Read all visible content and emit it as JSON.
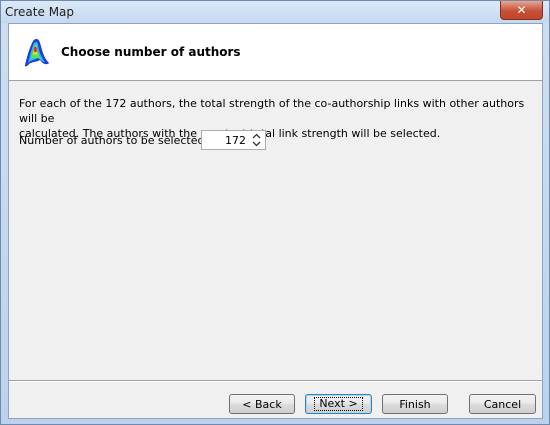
{
  "window": {
    "title": "Create Map",
    "close_glyph": "✕"
  },
  "header": {
    "title": "Choose number of authors",
    "logo_icon": "vosviewer-logo-icon"
  },
  "content": {
    "description_line1": "For each of the 172 authors, the total strength of the co-authorship links with other authors will be",
    "description_line2": "calculated. The authors with the greatest total link strength will be selected.",
    "field_label": "Number of authors to be selected:",
    "field_value": "172"
  },
  "buttons": {
    "back": "< Back",
    "next": "Next >",
    "finish": "Finish",
    "cancel": "Cancel"
  },
  "colors": {
    "titlebar": "#c5d8ef",
    "client_bg": "#f0f0f0",
    "close_button": "#c75037"
  }
}
